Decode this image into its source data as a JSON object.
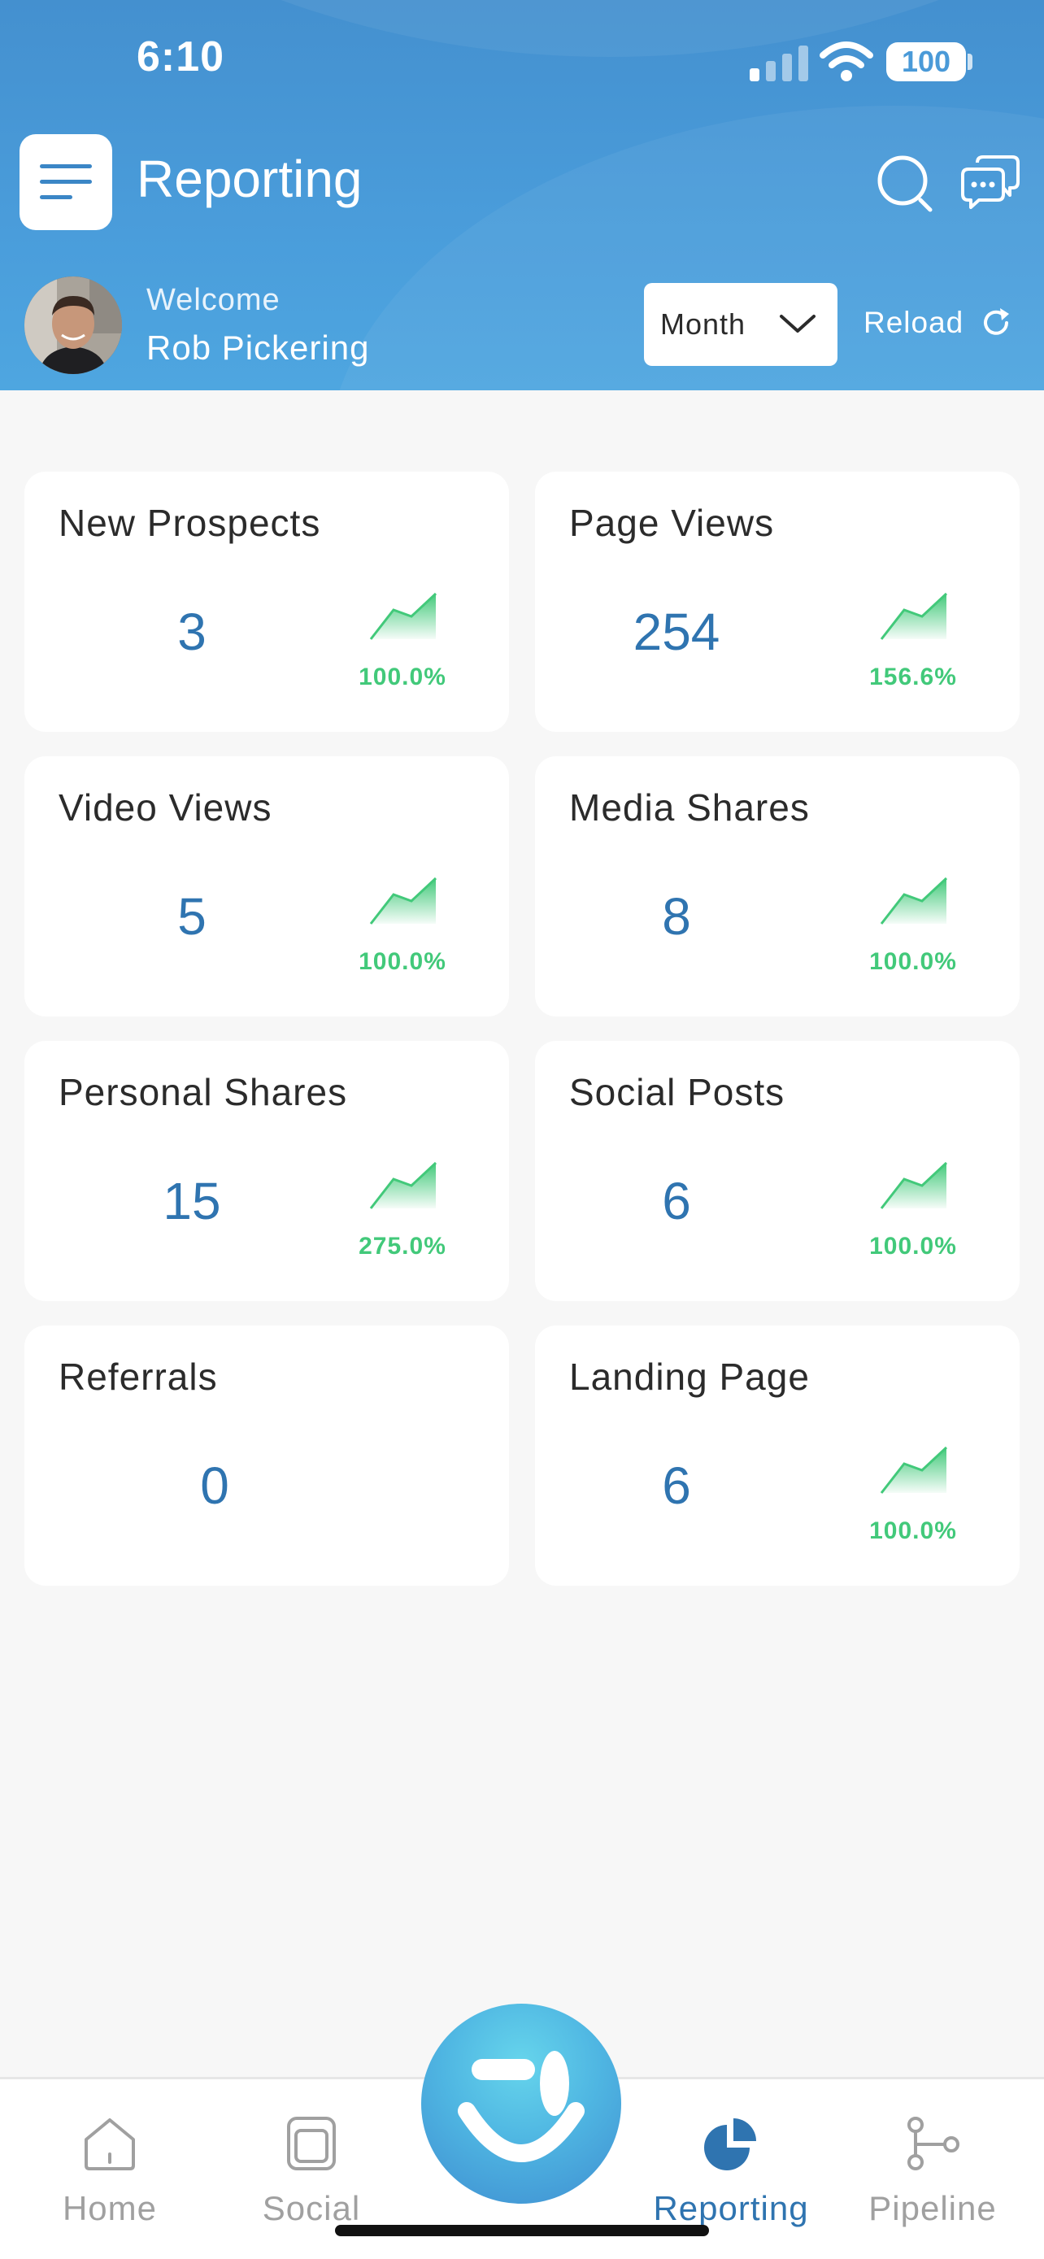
{
  "status_bar": {
    "time": "6:10",
    "battery": "100"
  },
  "header": {
    "title": "Reporting",
    "welcome": "Welcome",
    "user_name": "Rob Pickering",
    "period": "Month",
    "reload_label": "Reload"
  },
  "metrics": [
    {
      "label": "New Prospects",
      "value": "3",
      "change": "100.0%",
      "trend": "up"
    },
    {
      "label": "Page Views",
      "value": "254",
      "change": "156.6%",
      "trend": "up"
    },
    {
      "label": "Video Views",
      "value": "5",
      "change": "100.0%",
      "trend": "up"
    },
    {
      "label": "Media Shares",
      "value": "8",
      "change": "100.0%",
      "trend": "up"
    },
    {
      "label": "Personal Shares",
      "value": "15",
      "change": "275.0%",
      "trend": "up"
    },
    {
      "label": "Social Posts",
      "value": "6",
      "change": "100.0%",
      "trend": "up"
    },
    {
      "label": "Referrals",
      "value": "0",
      "change": "",
      "trend": "none"
    },
    {
      "label": "Landing Page",
      "value": "6",
      "change": "100.0%",
      "trend": "up"
    }
  ],
  "tabs": [
    {
      "label": "Home",
      "icon": "home-icon",
      "active": false
    },
    {
      "label": "Social",
      "icon": "social-icon",
      "active": false
    },
    {
      "label": "Reporting",
      "icon": "reporting-icon",
      "active": true
    },
    {
      "label": "Pipeline",
      "icon": "pipeline-icon",
      "active": false
    }
  ],
  "colors": {
    "header": "#4a9ad8",
    "accent": "#2f74b0",
    "positive": "#42c97a"
  }
}
